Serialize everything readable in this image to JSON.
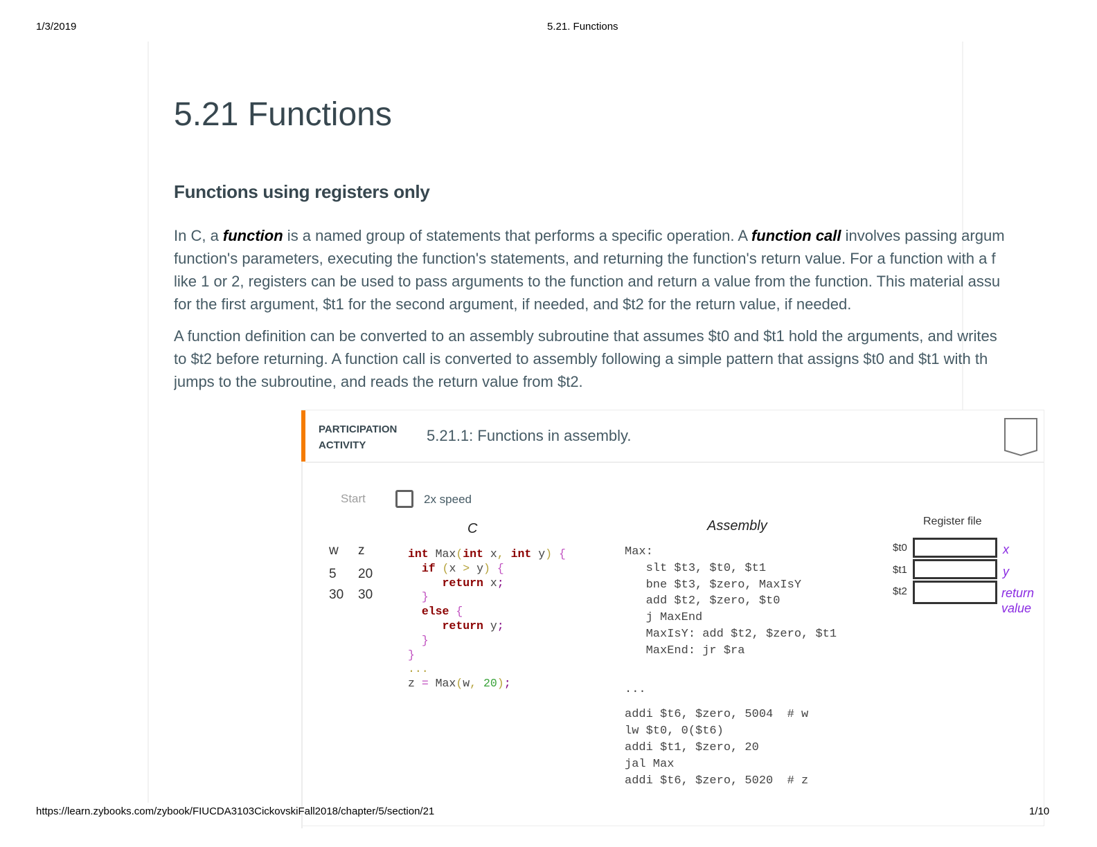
{
  "print_header": {
    "date": "1/3/2019",
    "title": "5.21. Functions"
  },
  "print_footer": {
    "url": "https://learn.zybooks.com/zybook/FIUCDA3103CickovskiFall2018/chapter/5/section/21",
    "page": "1/10"
  },
  "page": {
    "title": "5.21 Functions",
    "section_heading": "Functions using registers only",
    "paragraphs": [
      {
        "lines": [
          {
            "pre": "In C, a ",
            "bold1": "function",
            "mid": " is a named group of statements that performs a specific operation. A ",
            "bold2": "function call",
            "post": " involves passing argum"
          },
          {
            "text": "function's parameters, executing the function's statements, and returning the function's return value. For a function with a f"
          },
          {
            "text": "like 1 or 2, registers can be used to pass arguments to the function and return a value from the function. This material assu"
          },
          {
            "text": "for the first argument, $t1 for the second argument, if needed, and $t2 for the return value, if needed."
          }
        ]
      },
      {
        "lines": [
          {
            "text": "A function definition can be converted to an assembly subroutine that assumes $t0 and $t1 hold the arguments, and writes"
          },
          {
            "text": "to $t2 before returning. A function call is converted to assembly following a simple pattern that assigns $t0 and $t1 with th"
          },
          {
            "text": "jumps to the subroutine, and reads the return value from $t2."
          }
        ]
      }
    ]
  },
  "activity": {
    "type_label_line1": "PARTICIPATION",
    "type_label_line2": "ACTIVITY",
    "title": "5.21.1: Functions in assembly.",
    "accent_color": "#f57c00",
    "bookmark_icon": "bookmark-icon",
    "controls": {
      "start_label": "Start",
      "speed_label": "2x speed",
      "speed_checked": false
    },
    "animation": {
      "c_heading": "C",
      "assembly_heading": "Assembly",
      "variables": {
        "headers": [
          "w",
          "z"
        ],
        "rows": [
          [
            "5",
            "20"
          ],
          [
            "30",
            "30"
          ]
        ]
      },
      "c_code": {
        "kw_int": "int",
        "fn_name": "Max",
        "param_x": "x",
        "param_y": "y",
        "kw_if": "if",
        "cond_x": "x",
        "cond_op": ">",
        "cond_y": "y",
        "kw_return": "return",
        "ret_x": "x",
        "ret_y": "y",
        "kw_else": "else",
        "ellipsis": "...",
        "call_lhs": "z",
        "call_eq": "=",
        "call_arg1": "w",
        "call_arg2": "20"
      },
      "assembly_code": [
        "Max:",
        "   slt $t3, $t0, $t1",
        "   bne $t3, $zero, MaxIsY",
        "   add $t2, $zero, $t0",
        "   j MaxEnd",
        "   MaxIsY: add $t2, $zero, $t1",
        "   MaxEnd: jr $ra",
        "",
        "...",
        "",
        "addi $t6, $zero, 5004  # w",
        "lw $t0, 0($t6)",
        "addi $t1, $zero, 20",
        "jal Max",
        "addi $t6, $zero, 5020  # z"
      ],
      "register_file": {
        "title": "Register file",
        "registers": [
          {
            "name": "$t0",
            "annotation": "x"
          },
          {
            "name": "$t1",
            "annotation": "y"
          },
          {
            "name": "$t2",
            "annotation": "return value"
          }
        ]
      }
    }
  }
}
